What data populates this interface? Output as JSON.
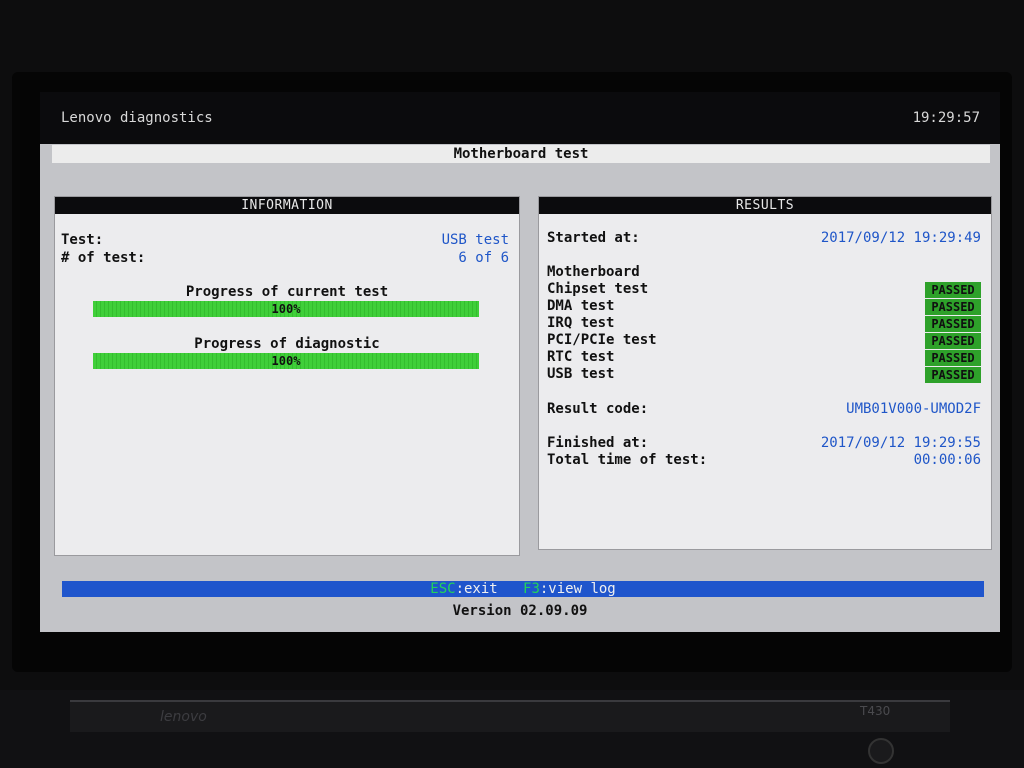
{
  "header": {
    "app_title": "Lenovo diagnostics",
    "clock": "19:29:57",
    "test_title": "Motherboard test"
  },
  "info_panel": {
    "title": "INFORMATION",
    "test_label": "Test:",
    "test_value": "USB test",
    "count_label": "# of test:",
    "count_value": "6 of 6",
    "progress_current": {
      "label": "Progress of current test",
      "text": "100%",
      "percent": 100
    },
    "progress_diagnostic": {
      "label": "Progress of diagnostic",
      "text": "100%",
      "percent": 100
    }
  },
  "results_panel": {
    "title": "RESULTS",
    "started_label": "Started at:",
    "started_value": "2017/09/12 19:29:49",
    "group": "Motherboard",
    "tests": [
      {
        "name": "Chipset test",
        "status": "PASSED"
      },
      {
        "name": "DMA test",
        "status": "PASSED"
      },
      {
        "name": "IRQ test",
        "status": "PASSED"
      },
      {
        "name": "PCI/PCIe test",
        "status": "PASSED"
      },
      {
        "name": "RTC test",
        "status": "PASSED"
      },
      {
        "name": "USB test",
        "status": "PASSED"
      }
    ],
    "result_code_label": "Result code:",
    "result_code_value": "UMB01V000-UMOD2F",
    "finished_label": "Finished at:",
    "finished_value": "2017/09/12 19:29:55",
    "total_label": "Total time of test:",
    "total_value": "00:00:06"
  },
  "footer": {
    "esc_key": "ESC",
    "esc_action": ":exit",
    "f3_key": "F3",
    "f3_action": ":view log",
    "version": "Version 02.09.09"
  },
  "hardware": {
    "brand": "lenovo",
    "model": "T430"
  },
  "colors": {
    "accent_blue": "#1f55cc",
    "value_blue": "#1f56c8",
    "pass_green": "#2ea12a",
    "progress_green": "#3fcf39"
  }
}
